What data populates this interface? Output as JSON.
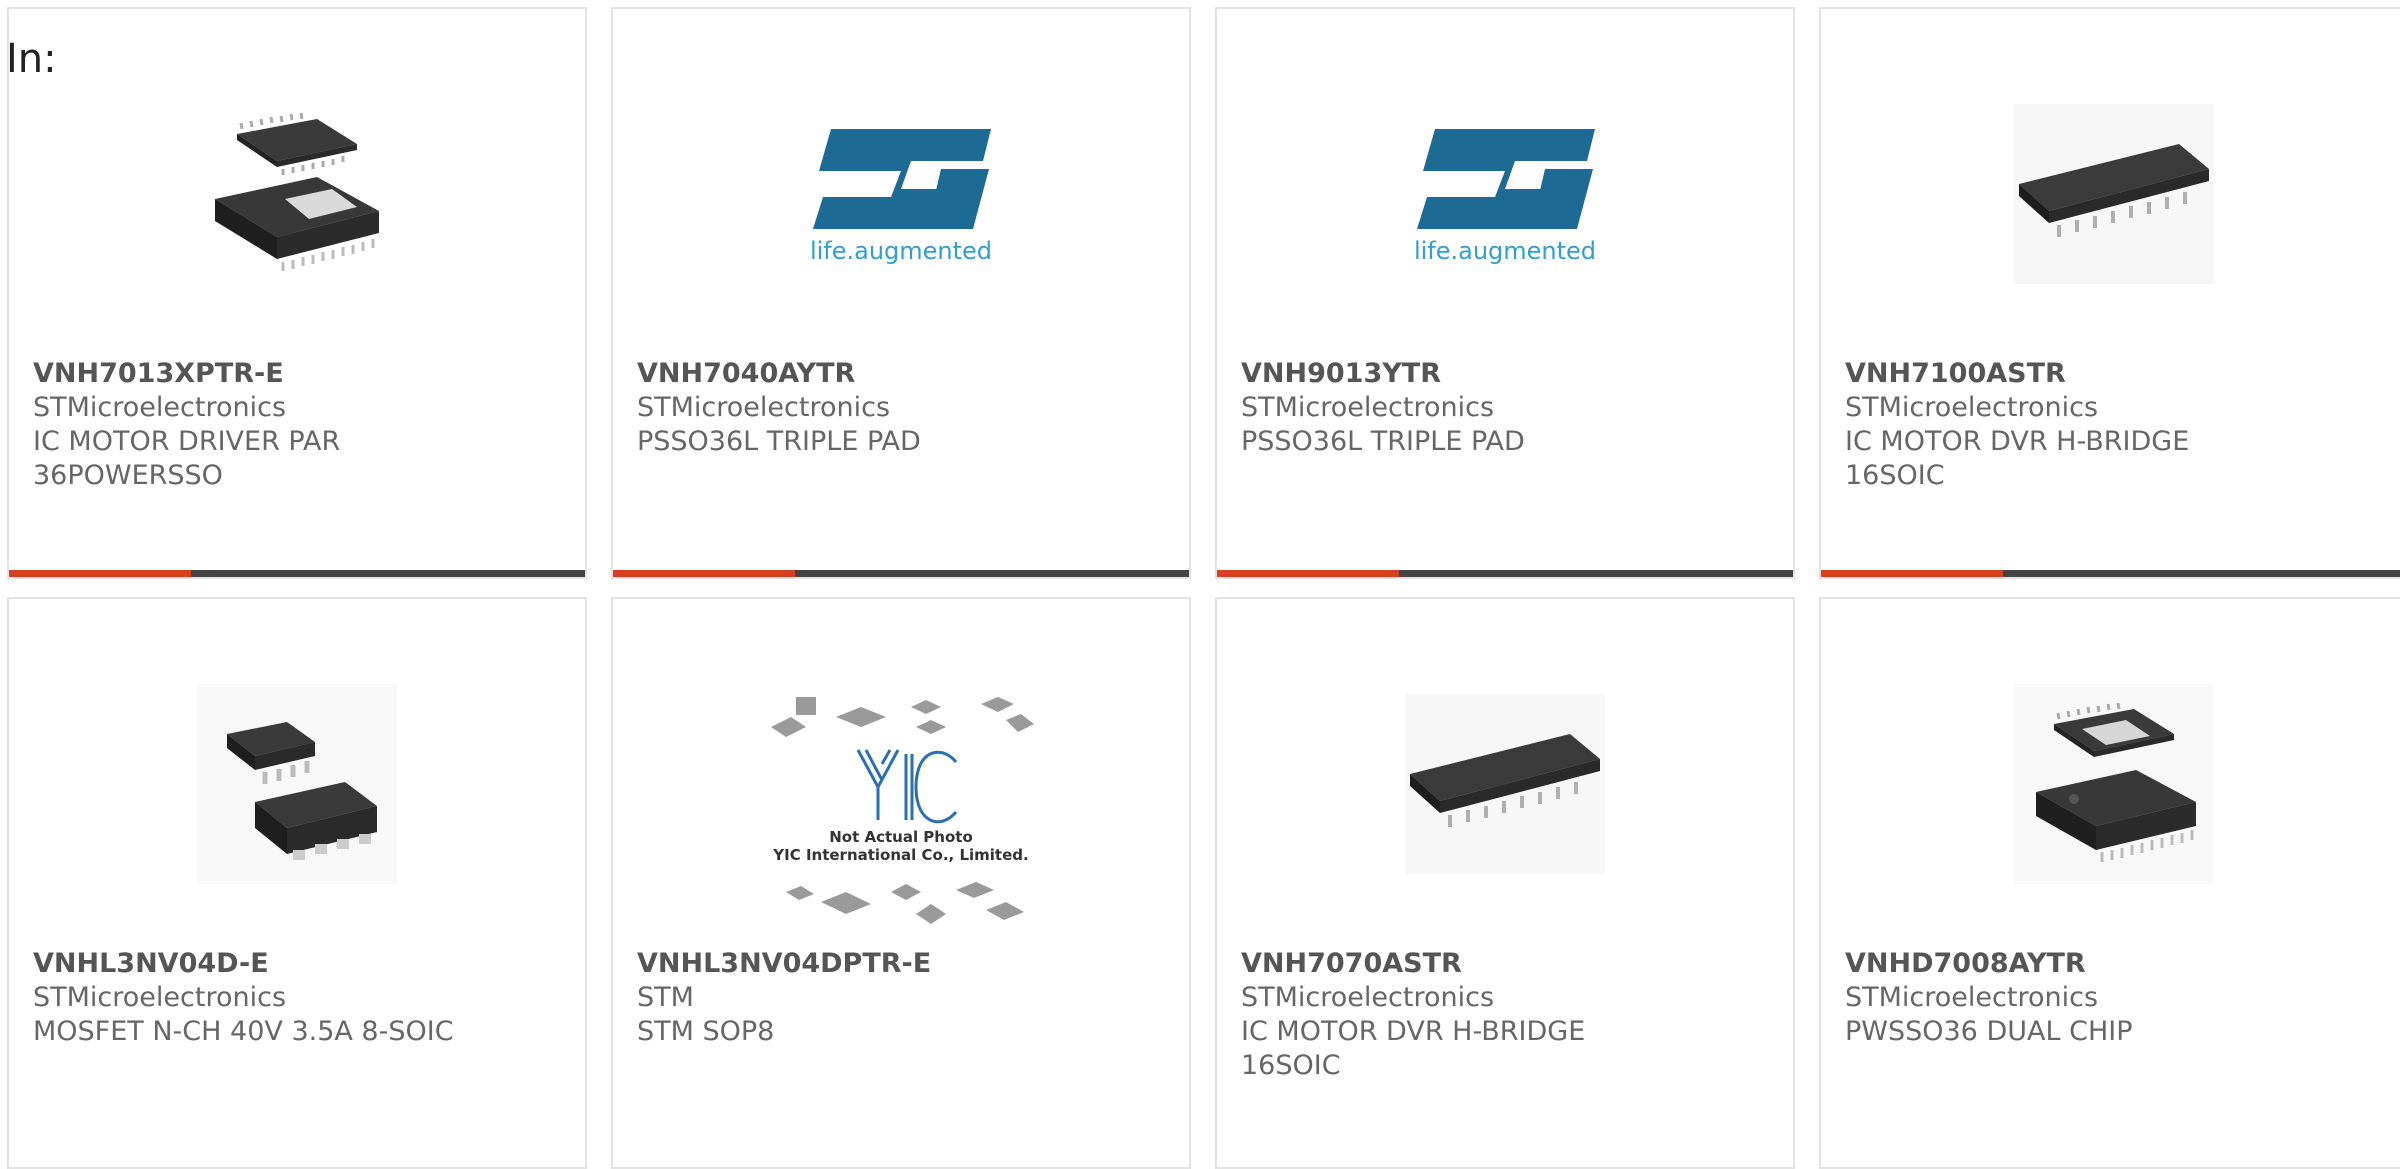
{
  "header": {
    "in_label": "In:"
  },
  "colors": {
    "accent": "#d6401e",
    "bar": "#444444",
    "text": "#666666",
    "title": "#555555",
    "st_logo": "#1d6a95",
    "st_text": "#2f9fd1"
  },
  "products": [
    {
      "part": "VNH7013XPTR-E",
      "maker": "STMicroelectronics",
      "desc": [
        "IC MOTOR DRIVER PAR",
        "36POWERSSO"
      ],
      "image": "ic-chip-photo-icon"
    },
    {
      "part": "VNH7040AYTR",
      "maker": "STMicroelectronics",
      "desc": [
        "PSSO36L TRIPLE PAD",
        ""
      ],
      "image": "st-logo",
      "logo_tagline": "life.augmented"
    },
    {
      "part": "VNH9013YTR",
      "maker": "STMicroelectronics",
      "desc": [
        "PSSO36L TRIPLE PAD",
        ""
      ],
      "image": "st-logo",
      "logo_tagline": "life.augmented"
    },
    {
      "part": "VNH7100ASTR",
      "maker": "STMicroelectronics",
      "desc": [
        "IC MOTOR DVR H-BRIDGE",
        "16SOIC"
      ],
      "image": "soic-chip-photo-icon"
    },
    {
      "part": "VNHL3NV04D-E",
      "maker": "STMicroelectronics",
      "desc": [
        "MOSFET N-CH 40V 3.5A 8-SOIC",
        ""
      ],
      "image": "soic8-chip-photo-icon"
    },
    {
      "part": "VNHL3NV04DPTR-E",
      "maker": "STM",
      "desc": [
        "STM SOP8",
        ""
      ],
      "image": "yic-placeholder",
      "placeholder_lines": [
        "Not Actual Photo",
        "YIC International Co., Limited."
      ]
    },
    {
      "part": "VNH7070ASTR",
      "maker": "STMicroelectronics",
      "desc": [
        "IC MOTOR DVR H-BRIDGE",
        "16SOIC"
      ],
      "image": "soic-chip-photo-icon"
    },
    {
      "part": "VNHD7008AYTR",
      "maker": "STMicroelectronics",
      "desc": [
        "PWSSO36 DUAL CHIP",
        ""
      ],
      "image": "ic-chip-photo-icon"
    }
  ]
}
